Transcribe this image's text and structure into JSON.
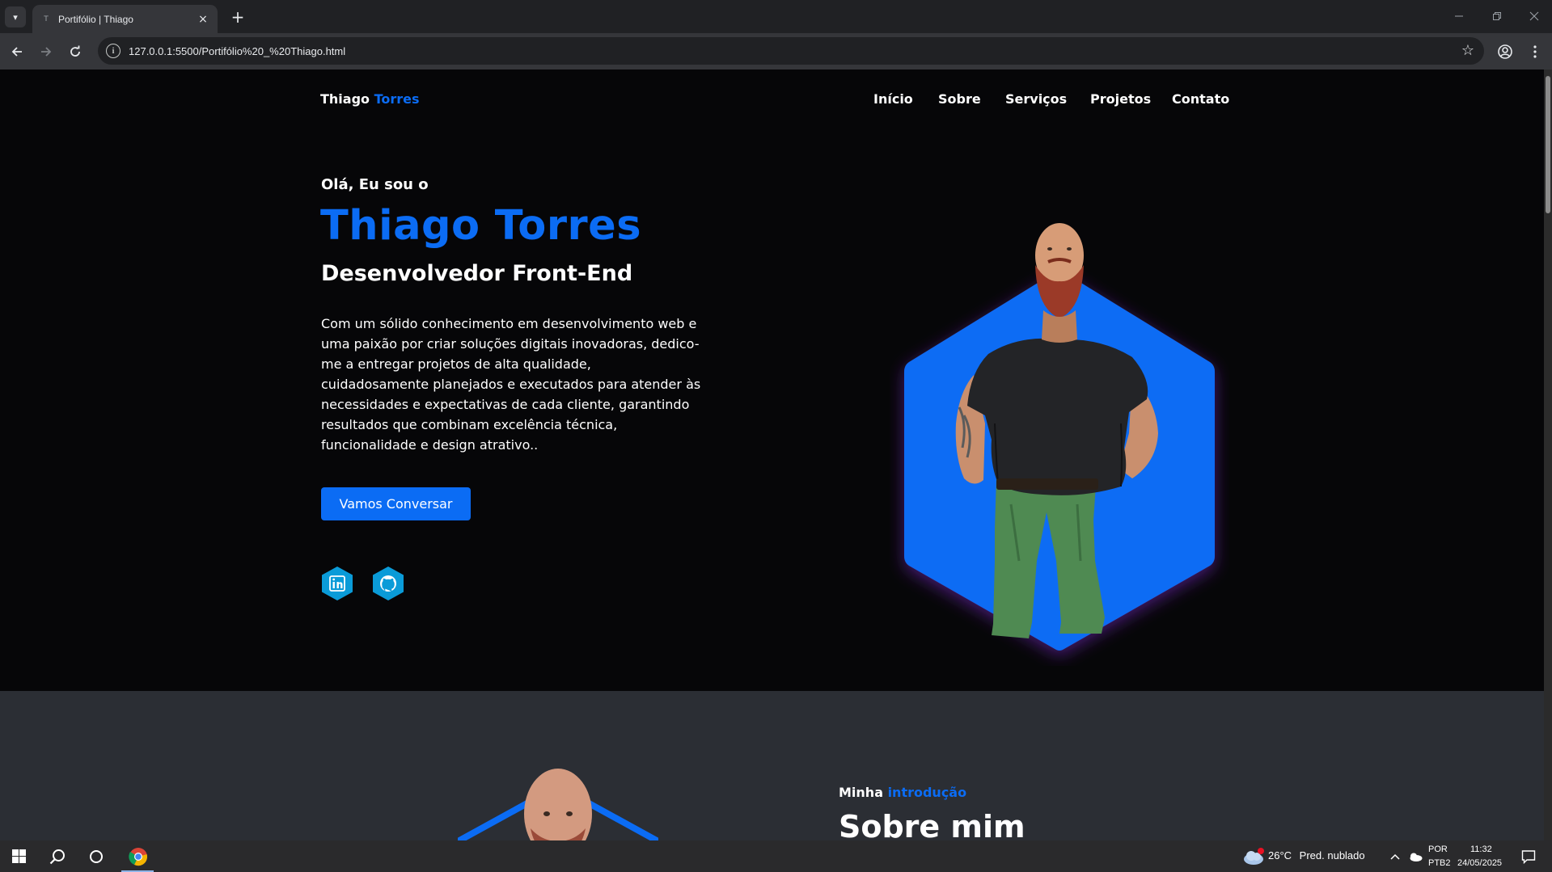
{
  "browser": {
    "tab_title": "Portifólio | Thiago",
    "tab_close": "×",
    "new_tab": "+",
    "url": "127.0.0.1:5500/Portifólio%20_%20Thiago.html",
    "icons": [
      "tab-list-icon",
      "back-arrow-icon",
      "forward-arrow-icon",
      "reload-icon",
      "site-info-icon",
      "bookmark-star-icon",
      "profile-icon",
      "menu-kebab-icon",
      "minimize-icon",
      "restore-icon",
      "close-window-icon"
    ]
  },
  "site": {
    "logo_first": "Thiago",
    "logo_accent": "Torres",
    "nav": [
      "Início",
      "Sobre",
      "Serviços",
      "Projetos",
      "Contato"
    ],
    "hero": {
      "greeting": "Olá, Eu sou o",
      "name": "Thiago Torres",
      "role": "Desenvolvedor Front-End",
      "description": "Com um sólido conhecimento em desenvolvimento web e uma paixão por criar soluções digitais inovadoras, dedico-me a entregar projetos de alta qualidade, cuidadosamente planejados e executados para atender às necessidades e expectativas de cada cliente, garantindo resultados que combinam excelência técnica, funcionalidade e design atrativo..",
      "cta": "Vamos Conversar",
      "social_icons": [
        "linkedin-icon",
        "github-icon"
      ]
    },
    "about": {
      "subtitle_first": "Minha",
      "subtitle_accent": "introdução",
      "title": "Sobre mim"
    },
    "colors": {
      "accent": "#0b6cf4",
      "hero_bg": "#060608",
      "about_bg": "#2b2e34",
      "social": "#0a9bd8"
    }
  },
  "taskbar": {
    "weather_temp": "26°C",
    "weather_desc": "Pred. nublado",
    "lang_top": "POR",
    "lang_bottom": "PTB2",
    "time": "11:32",
    "date": "24/05/2025",
    "icons": [
      "windows-start-icon",
      "search-icon",
      "cortana-icon",
      "chrome-icon",
      "weather-cloud-icon",
      "tray-chevron-icon",
      "onedrive-icon",
      "notifications-icon"
    ]
  }
}
